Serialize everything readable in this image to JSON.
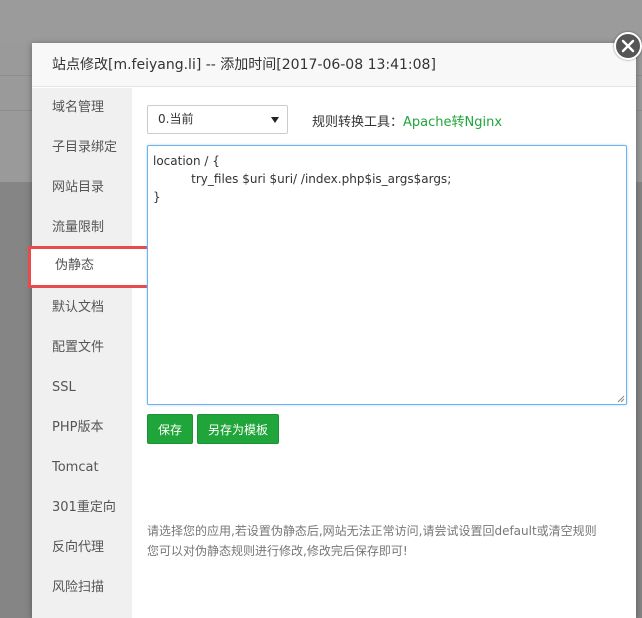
{
  "dialog": {
    "title": "站点修改[m.feiyang.li] -- 添加时间[2017-06-08 13:41:08]"
  },
  "sidebar": {
    "items": [
      {
        "label": "域名管理"
      },
      {
        "label": "子目录绑定"
      },
      {
        "label": "网站目录"
      },
      {
        "label": "流量限制"
      },
      {
        "label": "伪静态",
        "active": true
      },
      {
        "label": "默认文档"
      },
      {
        "label": "配置文件"
      },
      {
        "label": "SSL"
      },
      {
        "label": "PHP版本"
      },
      {
        "label": "Tomcat"
      },
      {
        "label": "301重定向"
      },
      {
        "label": "反向代理"
      },
      {
        "label": "风险扫描"
      }
    ]
  },
  "rewrite": {
    "selected_template": "0.当前",
    "tool_label": "规则转换工具：",
    "tool_link": "Apache转Nginx",
    "rules": "location / {\n\t  try_files $uri $uri/ /index.php$is_args$args;\n}",
    "save_label": "保存",
    "save_as_template_label": "另存为模板",
    "tips": [
      "请选择您的应用,若设置伪静态后,网站无法正常访问,请尝试设置回default或清空规则",
      "您可以对伪静态规则进行修改,修改完后保存即可!"
    ]
  },
  "colors": {
    "accent": "#20a53a",
    "highlight_border": "#e64c4c",
    "editor_border": "#6eb2f0"
  }
}
